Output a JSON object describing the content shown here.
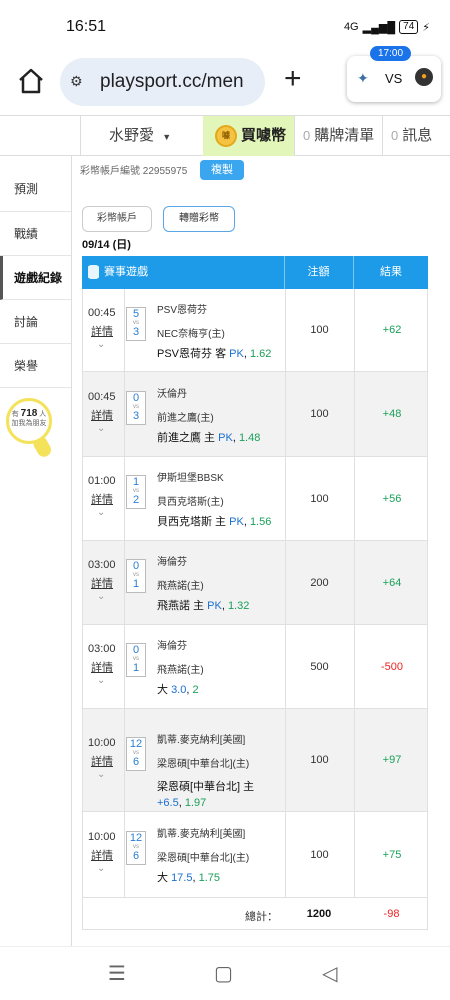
{
  "status_bar": {
    "time": "16:51",
    "network": "4G",
    "battery": "74"
  },
  "address_bar": {
    "url": "playsport.cc/men",
    "new_tab": "+",
    "score_widget": {
      "time": "17:00",
      "vs": "VS"
    }
  },
  "top_nav": {
    "user": "水野愛",
    "buy": "買噱幣",
    "coin_icon_text": "噱",
    "cart_count": "0",
    "cart_label": "購牌清單",
    "msg_count": "0",
    "msg_label": "訊息"
  },
  "side_nav": {
    "items": [
      {
        "label": "預測"
      },
      {
        "label": "戰績"
      },
      {
        "label": "遊戲紀錄"
      },
      {
        "label": "討論"
      },
      {
        "label": "榮譽"
      }
    ],
    "bulb": {
      "prefix": "有",
      "count": "718",
      "suffix": "人",
      "line2": "加我為朋友"
    }
  },
  "main": {
    "account_text": "彩幣帳戶編號 22955975",
    "copy_label": "複製",
    "tab_account": "彩幣帳戶",
    "tab_transfer": "轉贈彩幣",
    "date": "09/14 (日)",
    "table": {
      "headers": {
        "game": "賽事遊戲",
        "amount": "注額",
        "result": "結果"
      },
      "detail_label": "詳情",
      "vs": "vs",
      "rows": [
        {
          "time": "00:45",
          "score_a": "5",
          "score_b": "3",
          "team_a": "PSV恩荷芬",
          "team_b": "NEC奈梅亨(主)",
          "pick": "PSV恩荷芬 客",
          "pick_type": "PK",
          "odds": "1.62",
          "amount": "100",
          "result": "+62"
        },
        {
          "time": "00:45",
          "score_a": "0",
          "score_b": "3",
          "team_a": "沃倫丹",
          "team_b": "前進之鷹(主)",
          "pick": "前進之鷹 主",
          "pick_type": "PK",
          "odds": "1.48",
          "amount": "100",
          "result": "+48"
        },
        {
          "time": "01:00",
          "score_a": "1",
          "score_b": "2",
          "team_a": "伊斯坦堡BBSK",
          "team_b": "貝西克塔斯(主)",
          "pick": "貝西克塔斯 主",
          "pick_type": "PK",
          "odds": "1.56",
          "amount": "100",
          "result": "+56"
        },
        {
          "time": "03:00",
          "score_a": "0",
          "score_b": "1",
          "team_a": "海倫芬",
          "team_b": "飛燕諾(主)",
          "pick": "飛燕諾 主",
          "pick_type": "PK",
          "odds": "1.32",
          "amount": "200",
          "result": "+64"
        },
        {
          "time": "03:00",
          "score_a": "0",
          "score_b": "1",
          "team_a": "海倫芬",
          "team_b": "飛燕諾(主)",
          "pick": "大",
          "pick_type": "3.0",
          "odds": "2",
          "amount": "500",
          "result": "-500"
        },
        {
          "time": "10:00",
          "score_a": "12",
          "score_b": "6",
          "team_a": "凱蒂.麥克納利[美國]",
          "team_b": "梁恩碩[中華台北](主)",
          "pick": "梁恩碩[中華台北] 主",
          "pick_type": "+6.5",
          "odds": "1.97",
          "amount": "100",
          "result": "+97"
        },
        {
          "time": "10:00",
          "score_a": "12",
          "score_b": "6",
          "team_a": "凱蒂.麥克納利[美國]",
          "team_b": "梁恩碩[中華台北](主)",
          "pick": "大",
          "pick_type": "17.5",
          "odds": "1.75",
          "amount": "100",
          "result": "+75"
        }
      ],
      "total": {
        "label": "總計：",
        "amount": "1200",
        "result": "-98"
      }
    }
  },
  "colors": {
    "header_blue": "#1e9be8",
    "positive": "#1aa05a",
    "negative": "#e22222",
    "buy_bg": "#e3f6b9"
  }
}
